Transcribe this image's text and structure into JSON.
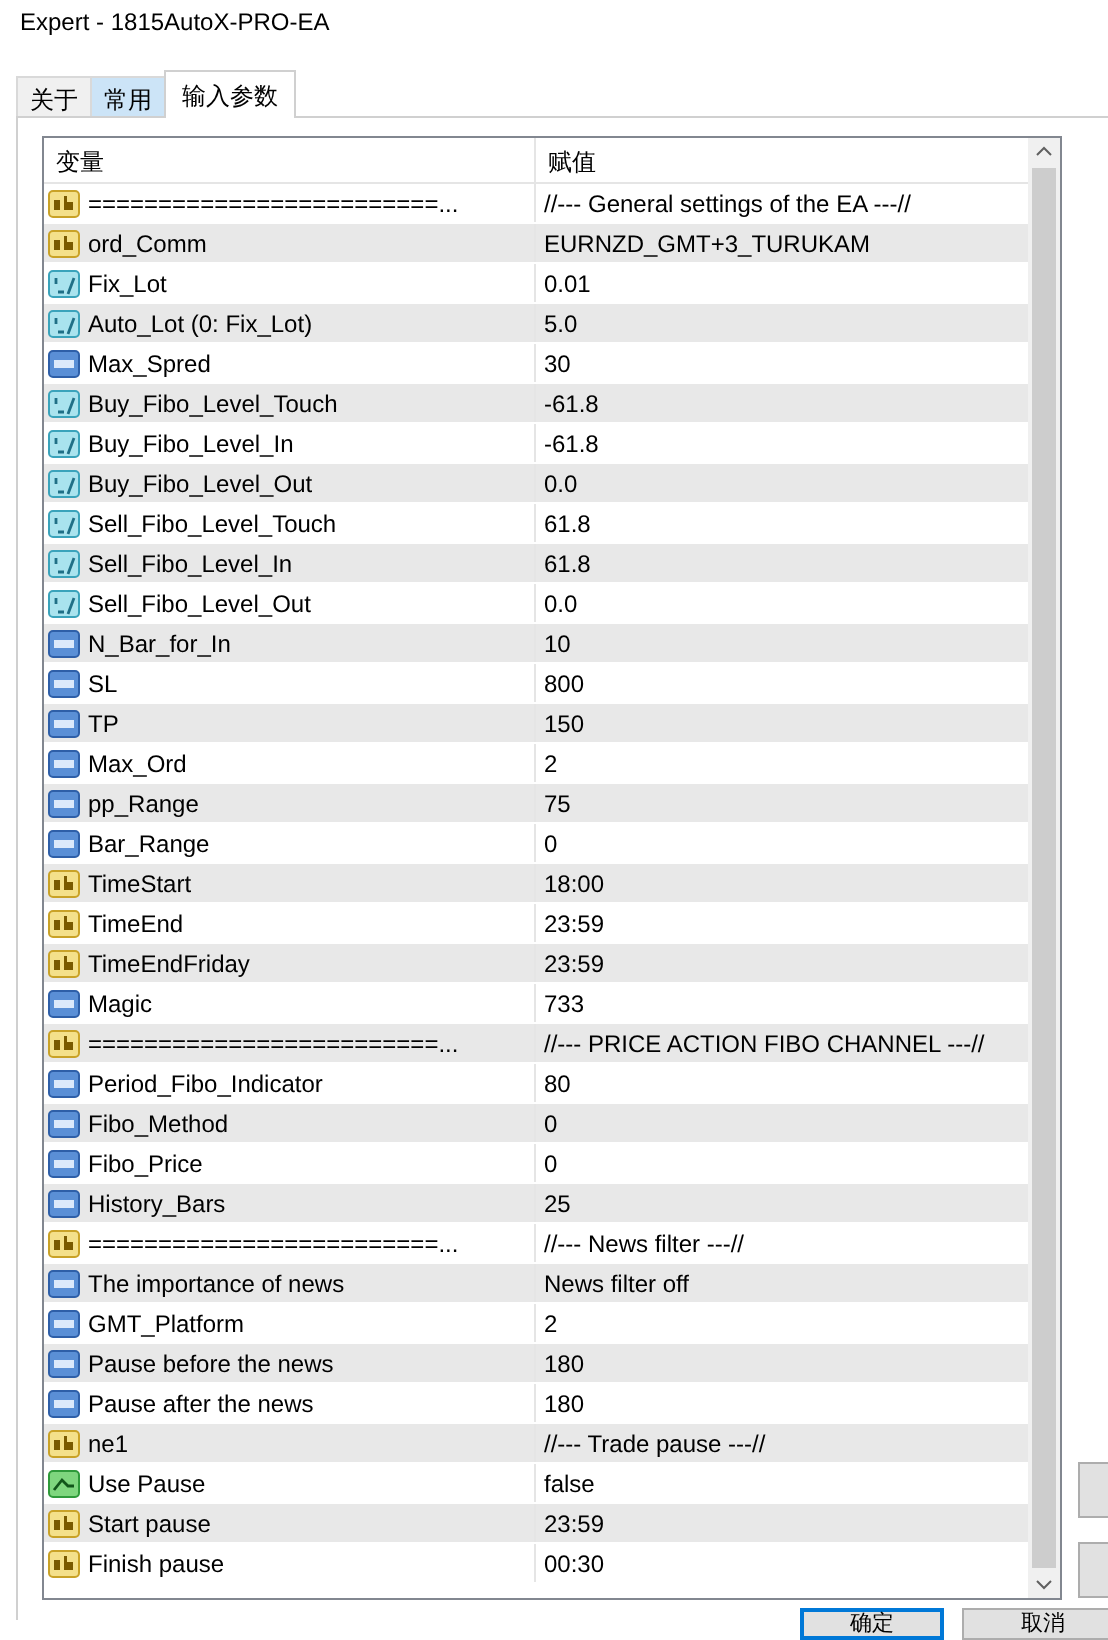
{
  "window": {
    "title": "Expert - 1815AutoX-PRO-EA"
  },
  "tabs": [
    {
      "label": "关于",
      "selected": false,
      "highlighted": false
    },
    {
      "label": "常用",
      "selected": false,
      "highlighted": true
    },
    {
      "label": "输入参数",
      "selected": true,
      "highlighted": false
    }
  ],
  "table": {
    "columns": [
      "变量",
      "赋值"
    ],
    "rows": [
      {
        "kind": "string",
        "name": "=========================...",
        "value": "//--- General settings of the EA ---//"
      },
      {
        "kind": "string",
        "name": "ord_Comm",
        "value": "EURNZD_GMT+3_TURUKAM"
      },
      {
        "kind": "double",
        "name": "Fix_Lot",
        "value": "0.01"
      },
      {
        "kind": "double",
        "name": "Auto_Lot (0: Fix_Lot)",
        "value": "5.0"
      },
      {
        "kind": "int",
        "name": "Max_Spred",
        "value": "30"
      },
      {
        "kind": "double",
        "name": "Buy_Fibo_Level_Touch",
        "value": "-61.8"
      },
      {
        "kind": "double",
        "name": "Buy_Fibo_Level_In",
        "value": "-61.8"
      },
      {
        "kind": "double",
        "name": "Buy_Fibo_Level_Out",
        "value": "0.0"
      },
      {
        "kind": "double",
        "name": "Sell_Fibo_Level_Touch",
        "value": "61.8"
      },
      {
        "kind": "double",
        "name": "Sell_Fibo_Level_In",
        "value": "61.8"
      },
      {
        "kind": "double",
        "name": "Sell_Fibo_Level_Out",
        "value": "0.0"
      },
      {
        "kind": "int",
        "name": "N_Bar_for_In",
        "value": "10"
      },
      {
        "kind": "int",
        "name": "SL",
        "value": "800"
      },
      {
        "kind": "int",
        "name": "TP",
        "value": "150"
      },
      {
        "kind": "int",
        "name": "Max_Ord",
        "value": "2"
      },
      {
        "kind": "int",
        "name": "pp_Range",
        "value": "75"
      },
      {
        "kind": "int",
        "name": "Bar_Range",
        "value": "0"
      },
      {
        "kind": "string",
        "name": "TimeStart",
        "value": "18:00"
      },
      {
        "kind": "string",
        "name": "TimeEnd",
        "value": "23:59"
      },
      {
        "kind": "string",
        "name": "TimeEndFriday",
        "value": "23:59"
      },
      {
        "kind": "int",
        "name": "Magic",
        "value": "733"
      },
      {
        "kind": "string",
        "name": "=========================...",
        "value": "//--- PRICE ACTION FIBO CHANNEL ---//"
      },
      {
        "kind": "int",
        "name": "Period_Fibo_Indicator",
        "value": "80"
      },
      {
        "kind": "int",
        "name": "Fibo_Method",
        "value": "0"
      },
      {
        "kind": "int",
        "name": "Fibo_Price",
        "value": "0"
      },
      {
        "kind": "int",
        "name": "History_Bars",
        "value": "25"
      },
      {
        "kind": "string",
        "name": "=========================...",
        "value": "//--- News filter ---//"
      },
      {
        "kind": "int",
        "name": "The importance of news",
        "value": "News filter off"
      },
      {
        "kind": "int",
        "name": "GMT_Platform",
        "value": "2"
      },
      {
        "kind": "int",
        "name": "Pause before the news",
        "value": "180"
      },
      {
        "kind": "int",
        "name": "Pause after the news",
        "value": "180"
      },
      {
        "kind": "string",
        "name": "ne1",
        "value": "//--- Trade pause ---//"
      },
      {
        "kind": "bool",
        "name": "Use Pause",
        "value": "false"
      },
      {
        "kind": "string",
        "name": "Start pause",
        "value": "23:59"
      },
      {
        "kind": "string",
        "name": "Finish pause",
        "value": "00:30"
      }
    ]
  },
  "buttons": [
    "确定",
    "取消"
  ]
}
